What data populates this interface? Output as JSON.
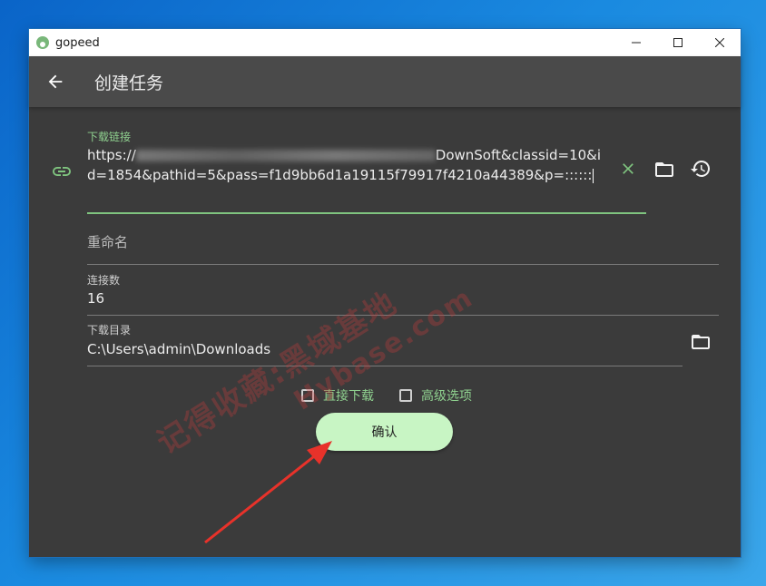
{
  "window": {
    "title": "gopeed",
    "controls": [
      "minimize-icon",
      "maximize-icon",
      "close-icon"
    ]
  },
  "appbar": {
    "back_icon": "arrow-left-icon",
    "title": "创建任务"
  },
  "form": {
    "url": {
      "label": "下载链接",
      "value_start": "https://",
      "value_end": "DownSoft&classid=10&id=1854&pathid=5&pass=f1d9bb6d1a19115f79917f4210a44389&p=::::::",
      "leading_icon": "link-icon",
      "actions": [
        "clear-icon",
        "folder-icon",
        "history-icon"
      ]
    },
    "rename": {
      "placeholder": "重命名"
    },
    "connections": {
      "label": "连接数",
      "value": "16"
    },
    "directory": {
      "label": "下载目录",
      "value": "C:\\Users\\admin\\Downloads",
      "action_icon": "folder-icon"
    },
    "options": {
      "direct_download": "直接下载",
      "advanced": "高级选项"
    },
    "confirm_label": "确认"
  },
  "watermark": {
    "line1": "记得收藏:黑域基地",
    "line2": "Hybase.com"
  },
  "colors": {
    "accent": "#7fc47f",
    "confirm_bg": "#c8f5c4",
    "window_bg": "#3b3b3b",
    "appbar_bg": "#4a4a4a"
  }
}
